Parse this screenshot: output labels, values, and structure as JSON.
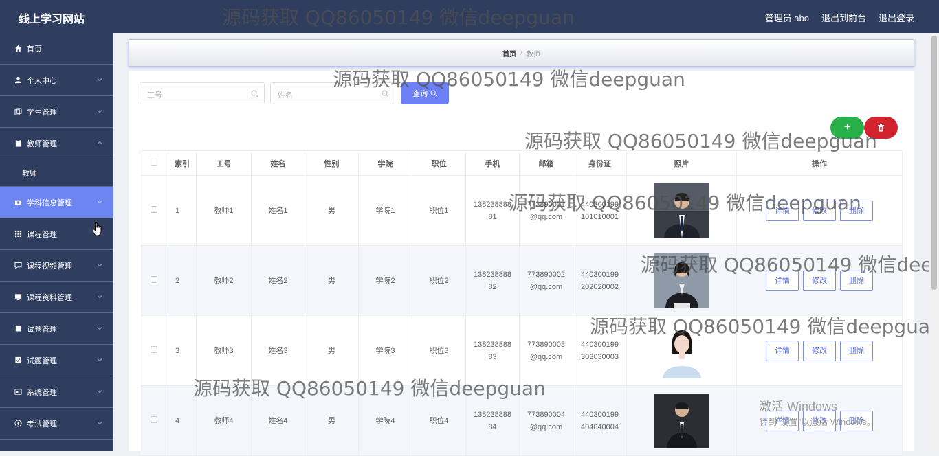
{
  "app": {
    "title": "线上学习网站"
  },
  "topbar": {
    "user": "管理员 abo",
    "to_front": "退出到前台",
    "logout": "退出登录"
  },
  "sidebar": {
    "items": [
      {
        "label": "首页",
        "icon": "home-icon"
      },
      {
        "label": "个人中心",
        "icon": "user-icon"
      },
      {
        "label": "学生管理",
        "icon": "copy-icon"
      },
      {
        "label": "教师管理",
        "icon": "clipboard-icon"
      },
      {
        "label": "教师",
        "icon": ""
      },
      {
        "label": "学科信息管理",
        "icon": "camera-icon"
      },
      {
        "label": "课程管理",
        "icon": "grid-icon"
      },
      {
        "label": "课程视频管理",
        "icon": "chat-icon"
      },
      {
        "label": "课程资料管理",
        "icon": "monitor-icon"
      },
      {
        "label": "试卷管理",
        "icon": "book-icon"
      },
      {
        "label": "试题管理",
        "icon": "checklist-icon"
      },
      {
        "label": "系统管理",
        "icon": "card-icon"
      },
      {
        "label": "考试管理",
        "icon": "compass-icon"
      }
    ]
  },
  "breadcrumb": {
    "home": "首页",
    "sep": "/",
    "current": "教师"
  },
  "search": {
    "no_placeholder": "工号",
    "name_placeholder": "姓名",
    "query_label": "查询"
  },
  "actions": {
    "add": "+",
    "delete": "🗑"
  },
  "table": {
    "headers": [
      "索引",
      "工号",
      "姓名",
      "性别",
      "学院",
      "职位",
      "手机",
      "邮箱",
      "身份证",
      "照片",
      "操作"
    ],
    "rows": [
      {
        "index": "1",
        "no": "教师1",
        "name": "姓名1",
        "gender": "男",
        "college": "学院1",
        "position": "职位1",
        "phone1": "138238888",
        "phone2": "81",
        "email1": "773890001",
        "email2": "@qq.com",
        "id1": "440300199",
        "id2": "101010001"
      },
      {
        "index": "2",
        "no": "教师2",
        "name": "姓名2",
        "gender": "男",
        "college": "学院2",
        "position": "职位2",
        "phone1": "138238888",
        "phone2": "82",
        "email1": "773890002",
        "email2": "@qq.com",
        "id1": "440300199",
        "id2": "202020002"
      },
      {
        "index": "3",
        "no": "教师3",
        "name": "姓名3",
        "gender": "男",
        "college": "学院3",
        "position": "职位3",
        "phone1": "138238888",
        "phone2": "83",
        "email1": "773890003",
        "email2": "@qq.com",
        "id1": "440300199",
        "id2": "303030003"
      },
      {
        "index": "4",
        "no": "教师4",
        "name": "姓名4",
        "gender": "男",
        "college": "学院4",
        "position": "职位4",
        "phone1": "138238888",
        "phone2": "84",
        "email1": "773890004",
        "email2": "@qq.com",
        "id1": "440300199",
        "id2": "404040004"
      }
    ],
    "ops": {
      "detail": "详情",
      "edit": "修改",
      "delete": "删除"
    }
  },
  "watermark": "源码获取 QQ86050149 微信deepguan",
  "windows": {
    "line1": "激活 Windows",
    "line2": "转到\"设置\"以激活 Windows。"
  },
  "colors": {
    "sidebar": "#2f3d5f",
    "accent": "#6c85f0",
    "add": "#28b04a",
    "delete": "#d1242f"
  }
}
